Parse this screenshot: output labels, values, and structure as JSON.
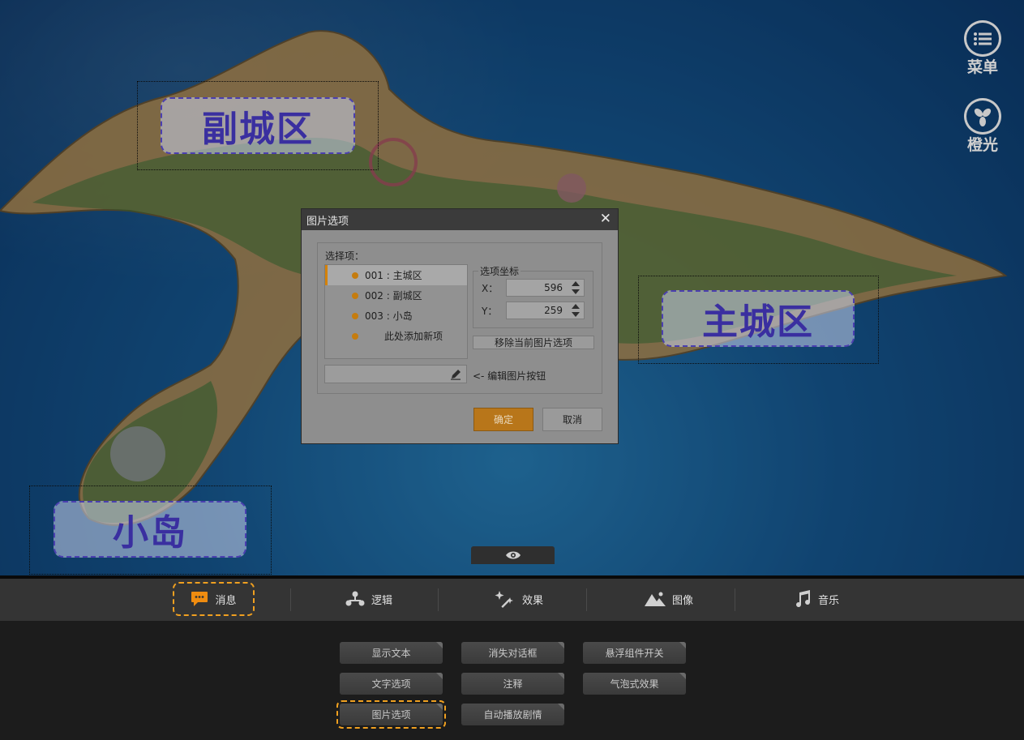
{
  "map": {
    "areas": [
      {
        "id": "sub-city",
        "label": "副城区"
      },
      {
        "id": "main-city",
        "label": "主城区"
      },
      {
        "id": "small-island",
        "label": "小岛"
      }
    ],
    "side_buttons": {
      "menu": {
        "label": "菜单",
        "icon": "list-icon"
      },
      "light": {
        "label": "橙光",
        "icon": "orange-light-icon"
      }
    },
    "preview_tab_icon": "eye-icon"
  },
  "dialog": {
    "title": "图片选项",
    "close_icon": "close-icon",
    "options_label": "选择项：",
    "options": [
      {
        "label": "001 : 主城区",
        "selected": true
      },
      {
        "label": "002 : 副城区",
        "selected": false
      },
      {
        "label": "003 : 小岛",
        "selected": false
      }
    ],
    "add_new_label": "此处添加新项",
    "coord_group": "选项坐标",
    "x_label": "X：",
    "x_value": "596",
    "y_label": "Y：",
    "y_value": "259",
    "remove_label": "移除当前图片选项",
    "edit_hint": "<- 编辑图片按钮",
    "ok_label": "确定",
    "cancel_label": "取消",
    "accent_color": "#b8761a"
  },
  "toolbar": {
    "tabs": [
      {
        "label": "消息",
        "icon": "message-icon",
        "active": true
      },
      {
        "label": "逻辑",
        "icon": "logic-icon",
        "active": false
      },
      {
        "label": "效果",
        "icon": "effects-icon",
        "active": false
      },
      {
        "label": "图像",
        "icon": "image-icon",
        "active": false
      },
      {
        "label": "音乐",
        "icon": "music-icon",
        "active": false
      }
    ],
    "commands": [
      {
        "label": "显示文本"
      },
      {
        "label": "消失对话框"
      },
      {
        "label": "悬浮组件开关"
      },
      {
        "label": "文字选项"
      },
      {
        "label": "注释"
      },
      {
        "label": "气泡式效果"
      },
      {
        "label": "图片选项",
        "selected": true
      },
      {
        "label": "自动播放剧情"
      }
    ],
    "highlight_color": "#f0a020"
  }
}
